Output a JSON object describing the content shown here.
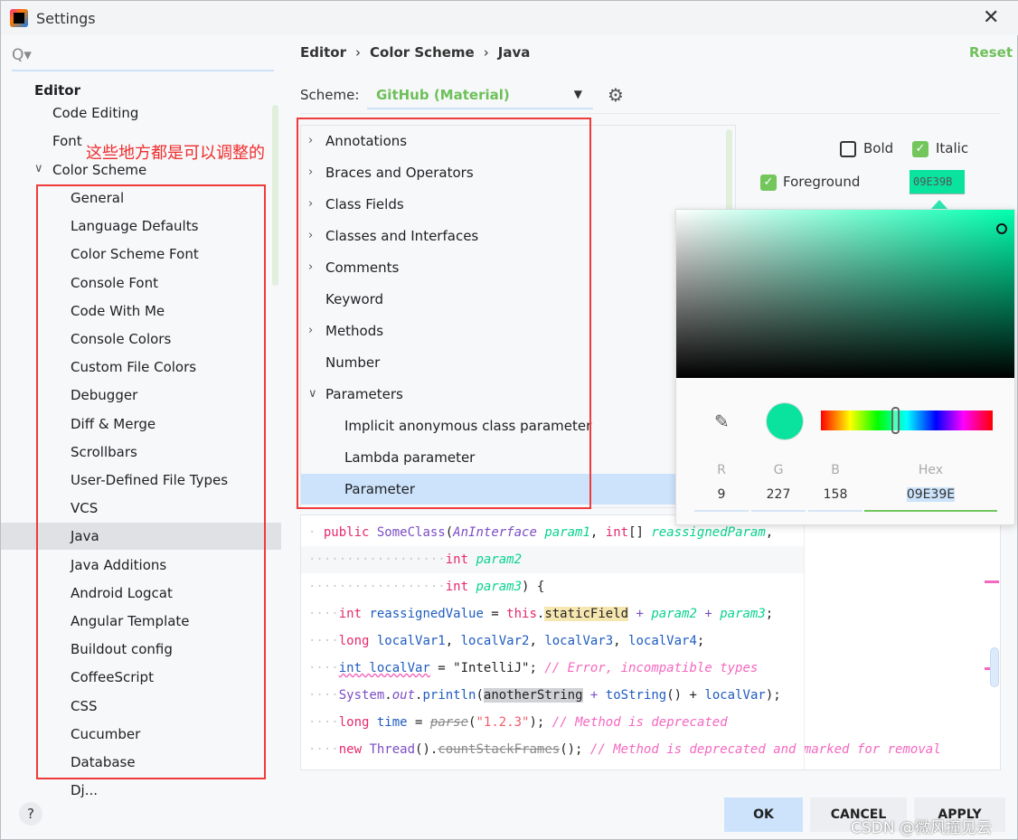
{
  "window": {
    "title": "Settings",
    "close": "✕"
  },
  "search": {
    "icon": "Q▾"
  },
  "sidebar": {
    "header": "Editor",
    "top_items": [
      {
        "label": "Code Editing"
      },
      {
        "label": "Font"
      },
      {
        "label": "Color Scheme",
        "expanded": true
      }
    ],
    "items": [
      "General",
      "Language Defaults",
      "Color Scheme Font",
      "Console Font",
      "Code With Me",
      "Console Colors",
      "Custom File Colors",
      "Debugger",
      "Diff & Merge",
      "Scrollbars",
      "User-Defined File Types",
      "VCS",
      "Java",
      "Java Additions",
      "Android Logcat",
      "Angular Template",
      "Buildout config",
      "CoffeeScript",
      "CSS",
      "Cucumber",
      "Database",
      "Dj..."
    ],
    "selected": "Java",
    "chevron": "∨"
  },
  "annotation": "这些地方都是可以调整的",
  "breadcrumb": [
    "Editor",
    "Color Scheme",
    "Java"
  ],
  "breadcrumb_sep": "›",
  "reset": "Reset",
  "scheme": {
    "label": "Scheme:",
    "value": "GitHub (Material)",
    "arrow": "▼",
    "gear": "⚙"
  },
  "tree": [
    {
      "label": "Annotations",
      "chev": "›"
    },
    {
      "label": "Braces and Operators",
      "chev": "›"
    },
    {
      "label": "Class Fields",
      "chev": "›"
    },
    {
      "label": "Classes and Interfaces",
      "chev": "›"
    },
    {
      "label": "Comments",
      "chev": "›"
    },
    {
      "label": "Keyword",
      "chev": ""
    },
    {
      "label": "Methods",
      "chev": "›"
    },
    {
      "label": "Number",
      "chev": ""
    },
    {
      "label": "Parameters",
      "chev": "∨"
    },
    {
      "label": "Implicit anonymous class parameter",
      "child": true
    },
    {
      "label": "Lambda parameter",
      "child": true
    },
    {
      "label": "Parameter",
      "child": true,
      "selected": true
    }
  ],
  "options": {
    "bold": "Bold",
    "bold_checked": false,
    "italic": "Italic",
    "italic_checked": true,
    "foreground": "Foreground",
    "foreground_checked": true,
    "foreground_value": "09E39B",
    "check": "✓"
  },
  "picker": {
    "labels": {
      "r": "R",
      "g": "G",
      "b": "B",
      "hex": "Hex"
    },
    "r": "9",
    "g": "227",
    "b": "158",
    "hex": "09E39E",
    "color": "#09e39e",
    "eyedropper": "✎",
    "hue_position": 0.43
  },
  "code": [
    [
      [
        "· ",
        "ws"
      ],
      [
        "public",
        "kw"
      ],
      [
        " ",
        "ws"
      ],
      [
        "SomeClass",
        "cls"
      ],
      [
        "(",
        "pl"
      ],
      [
        "AnInterface",
        "cls it"
      ],
      [
        " ",
        "ws"
      ],
      [
        "param1",
        "par"
      ],
      [
        ", ",
        "pl"
      ],
      [
        "int",
        "kw"
      ],
      [
        "[] ",
        "pl"
      ],
      [
        "reassignedParam",
        "par"
      ],
      [
        ",",
        "pl"
      ]
    ],
    [
      [
        "··················",
        "ws"
      ],
      [
        "int",
        "kw"
      ],
      [
        " ",
        "ws"
      ],
      [
        "param2",
        "par"
      ]
    ],
    [
      [
        "··················",
        "ws"
      ],
      [
        "int",
        "kw"
      ],
      [
        " ",
        "ws"
      ],
      [
        "param3",
        "par"
      ],
      [
        ") {",
        "pl"
      ]
    ],
    [
      [
        "····",
        "ws"
      ],
      [
        "int",
        "kw"
      ],
      [
        " reassignedValue",
        "lv"
      ],
      [
        " = ",
        "pl"
      ],
      [
        "this",
        "kw"
      ],
      [
        ".",
        "pl"
      ],
      [
        "staticField",
        "pl sf"
      ],
      [
        " + ",
        "cls"
      ],
      [
        "param2",
        "par"
      ],
      [
        " + ",
        "cls"
      ],
      [
        "param3",
        "par"
      ],
      [
        ";",
        "pl"
      ]
    ],
    [
      [
        "····",
        "ws"
      ],
      [
        "long",
        "kw"
      ],
      [
        " localVar1",
        "lv"
      ],
      [
        ", ",
        "pl"
      ],
      [
        "localVar2",
        "lv"
      ],
      [
        ", ",
        "pl"
      ],
      [
        "localVar3",
        "lv"
      ],
      [
        ", ",
        "pl"
      ],
      [
        "localVar4",
        "lv"
      ],
      [
        ";",
        "pl"
      ]
    ],
    [
      [
        "····",
        "ws"
      ],
      [
        "int localVar",
        "lv err"
      ],
      [
        " = ",
        "pl"
      ],
      [
        "\"IntelliJ\"",
        "str"
      ],
      [
        "; ",
        "pl"
      ],
      [
        "// Error, incompatible types",
        "cm"
      ]
    ],
    [
      [
        "····",
        "ws"
      ],
      [
        "System",
        "cls"
      ],
      [
        ".",
        "pl"
      ],
      [
        "out",
        "cls it"
      ],
      [
        ".",
        "pl"
      ],
      [
        "println",
        "lv"
      ],
      [
        "(",
        "pl"
      ],
      [
        "anotherString",
        "pl as"
      ],
      [
        " + ",
        "cls"
      ],
      [
        "toString",
        "lv"
      ],
      [
        "() + ",
        "pl"
      ],
      [
        "localVar",
        "lv"
      ],
      [
        ");",
        "pl"
      ]
    ],
    [
      [
        "····",
        "ws"
      ],
      [
        "long",
        "kw"
      ],
      [
        " time",
        "lv"
      ],
      [
        " = ",
        "pl"
      ],
      [
        "parse",
        "cls it dep"
      ],
      [
        "(",
        "pl"
      ],
      [
        "\"1.2.3\"",
        "num"
      ],
      [
        "); ",
        "pl"
      ],
      [
        "// Method is deprecated",
        "cm"
      ]
    ],
    [
      [
        "····",
        "ws"
      ],
      [
        "new",
        "kw"
      ],
      [
        " Thread",
        "cls"
      ],
      [
        "().",
        "pl"
      ],
      [
        "countStackFrames",
        "dep"
      ],
      [
        "(); ",
        "pl"
      ],
      [
        "// Method is deprecated and marked for removal",
        "cm"
      ]
    ]
  ],
  "footer": {
    "help": "?",
    "ok": "OK",
    "cancel": "CANCEL",
    "apply": "APPLY"
  },
  "watermark": "CSDN @微风撞见云"
}
